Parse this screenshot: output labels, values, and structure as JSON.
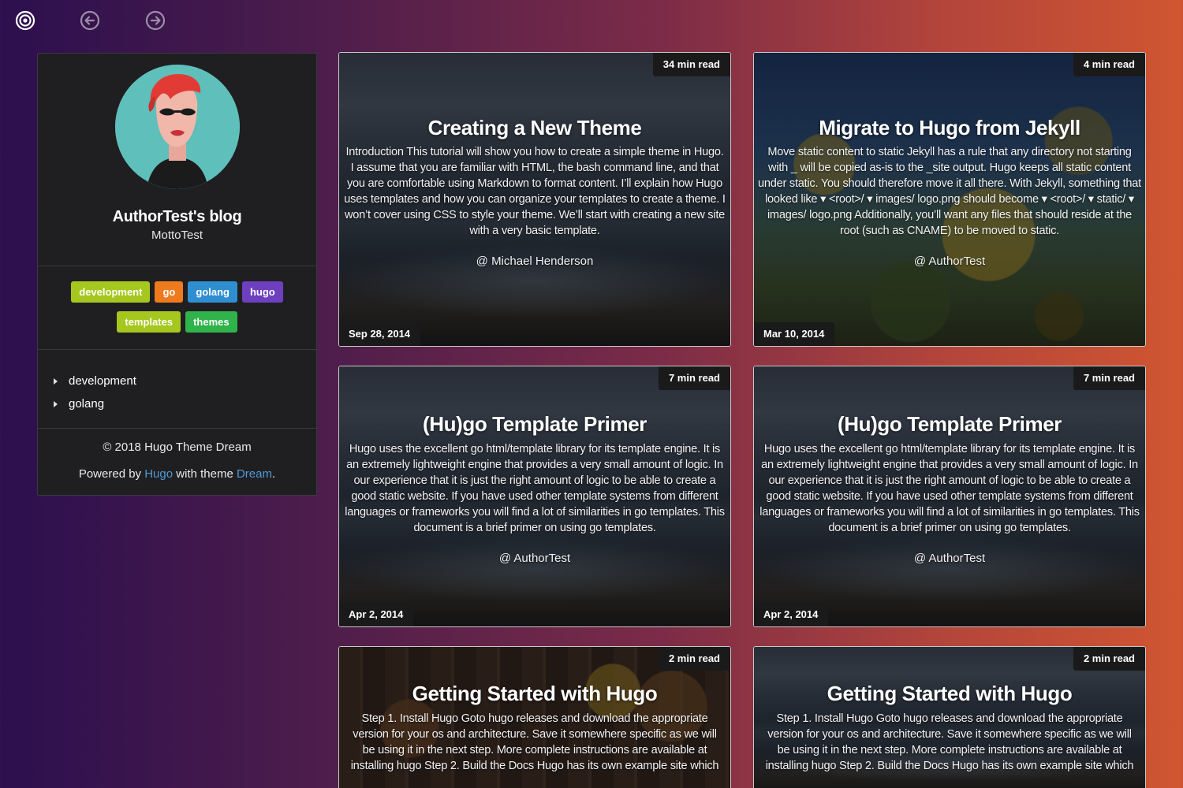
{
  "nav": {
    "home_icon": "target-icon",
    "back_icon": "arrow-left-circle-icon",
    "forward_icon": "arrow-right-circle-icon"
  },
  "sidebar": {
    "blog_title": "AuthorTest's blog",
    "motto": "MottoTest",
    "tags": [
      {
        "label": "development",
        "color": "#a5c71e"
      },
      {
        "label": "go",
        "color": "#ee7a1e"
      },
      {
        "label": "golang",
        "color": "#2f8ed0"
      },
      {
        "label": "hugo",
        "color": "#6e3fbf"
      },
      {
        "label": "templates",
        "color": "#a5c71e"
      },
      {
        "label": "themes",
        "color": "#2fb34a"
      }
    ],
    "categories": [
      "development",
      "golang"
    ],
    "copyright": "© 2018 Hugo Theme Dream",
    "powered_prefix": "Powered by",
    "powered_hugo": "Hugo",
    "powered_middle": "with theme",
    "powered_dream": "Dream",
    "powered_suffix": "."
  },
  "posts": [
    {
      "read_time": "34 min read",
      "title": "Creating a New Theme",
      "summary": "Introduction This tutorial will show you how to create a simple theme in Hugo. I assume that you are familiar with HTML, the bash command line, and that you are comfortable using Markdown to format content. I’ll explain how Hugo uses templates and how you can organize your templates to create a theme. I won’t cover using CSS to style your theme. We’ll start with creating a new site with a very basic template.",
      "author": "@ Michael Henderson",
      "date": "Sep 28, 2014"
    },
    {
      "read_time": "4 min read",
      "title": "Migrate to Hugo from Jekyll",
      "summary": "Move static content to static Jekyll has a rule that any directory not starting with _ will be copied as-is to the _site output. Hugo keeps all static content under static. You should therefore move it all there. With Jekyll, something that looked like ▾ <root>/ ▾ images/ logo.png should become ▾ <root>/ ▾ static/ ▾ images/ logo.png Additionally, you’ll want any files that should reside at the root (such as CNAME) to be moved to static.",
      "author": "@ AuthorTest",
      "date": "Mar 10, 2014"
    },
    {
      "read_time": "7 min read",
      "title": "(Hu)go Template Primer",
      "summary": "Hugo uses the excellent go html/template library for its template engine. It is an extremely lightweight engine that provides a very small amount of logic. In our experience that it is just the right amount of logic to be able to create a good static website. If you have used other template systems from different languages or frameworks you will find a lot of similarities in go templates. This document is a brief primer on using go templates.",
      "author": "@ AuthorTest",
      "date": "Apr 2, 2014"
    },
    {
      "read_time": "7 min read",
      "title": "(Hu)go Template Primer",
      "summary": "Hugo uses the excellent go html/template library for its template engine. It is an extremely lightweight engine that provides a very small amount of logic. In our experience that it is just the right amount of logic to be able to create a good static website. If you have used other template systems from different languages or frameworks you will find a lot of similarities in go templates. This document is a brief primer on using go templates.",
      "author": "@ AuthorTest",
      "date": "Apr 2, 2014"
    },
    {
      "read_time": "2 min read",
      "title": "Getting Started with Hugo",
      "summary": "Step 1. Install Hugo Goto hugo releases and download the appropriate version for your os and architecture. Save it somewhere specific as we will be using it in the next step. More complete instructions are available at installing hugo Step 2. Build the Docs Hugo has its own example site which",
      "author": "",
      "date": ""
    },
    {
      "read_time": "2 min read",
      "title": "Getting Started with Hugo",
      "summary": "Step 1. Install Hugo Goto hugo releases and download the appropriate version for your os and architecture. Save it somewhere specific as we will be using it in the next step. More complete instructions are available at installing hugo Step 2. Build the Docs Hugo has its own example site which",
      "author": "",
      "date": ""
    }
  ]
}
